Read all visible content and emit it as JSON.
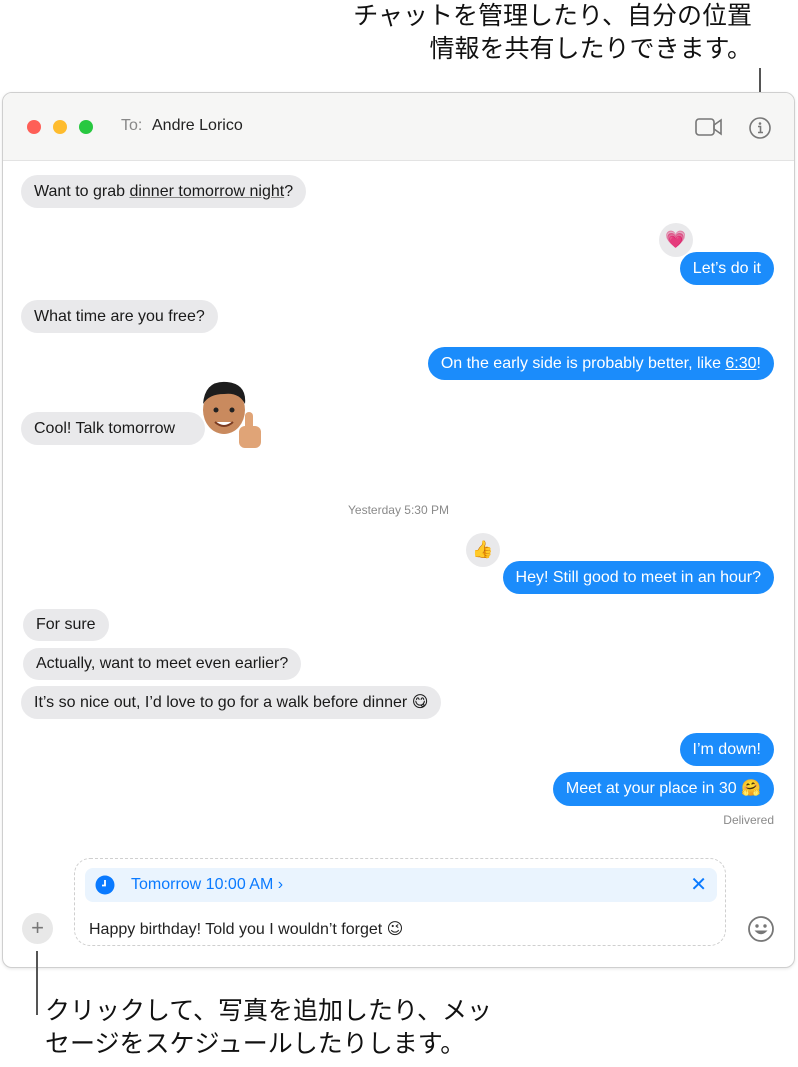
{
  "callouts": {
    "top": [
      "チャットを管理したり、自分の位置",
      "情報を共有したりできます。"
    ],
    "bottom": [
      "クリックして、写真を追加したり、メッ",
      "セージをスケジュールしたりします。"
    ]
  },
  "header": {
    "to_label": "To:",
    "recipient": "Andre Lorico",
    "icons": [
      "facetime-video-icon",
      "info-icon"
    ]
  },
  "messages": [
    {
      "from": "them",
      "pre": "Want to grab ",
      "link": "dinner tomorrow night",
      "post": "?"
    },
    {
      "from": "me",
      "text": "Let’s do it",
      "tapback": "💗"
    },
    {
      "from": "them",
      "text": "What time are you free?"
    },
    {
      "from": "me",
      "pre": "On the early side is probably better, like ",
      "link": "6:30",
      "post": "!"
    },
    {
      "from": "them",
      "text": "Cool! Talk tomorrow",
      "sticker": "memoji-thumbs-up"
    },
    {
      "from": "me",
      "text": "Hey! Still good to meet in an hour?",
      "tapback": "👍"
    },
    {
      "from": "them",
      "text": "For sure"
    },
    {
      "from": "them",
      "text": "Actually, want to meet even earlier?"
    },
    {
      "from": "them",
      "text": "It’s so nice out, I’d love to go for a walk before dinner 😋"
    },
    {
      "from": "me",
      "text": "I’m down!"
    },
    {
      "from": "me",
      "text": "Meet at your place in 30 🤗"
    }
  ],
  "timestamp": "Yesterday 5:30 PM",
  "status": "Delivered",
  "compose": {
    "schedule": "Tomorrow 10:00 AM ›",
    "text": "Happy birthday! Told you I wouldn’t forget 😉"
  },
  "colors": {
    "sent": "#1b8cfb",
    "received": "#e9e9eb",
    "schedule_bg": "#eaf4fe",
    "accent": "#0a7aff"
  }
}
